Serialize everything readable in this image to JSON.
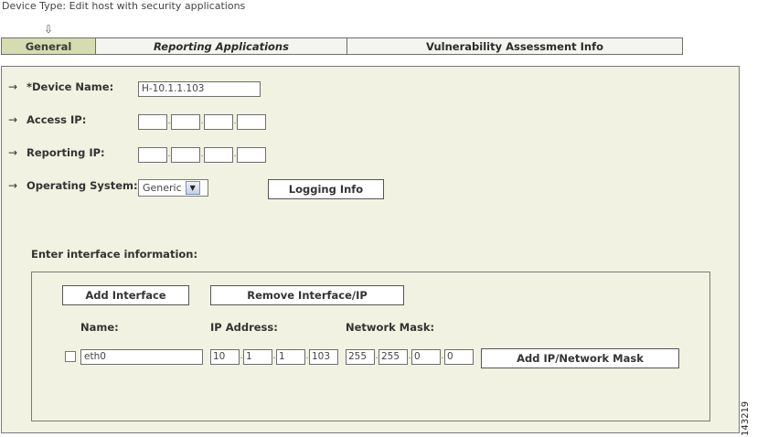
{
  "header": {
    "device_type_label": "Device Type:",
    "device_type_value": " Edit host with security applications"
  },
  "tabs": [
    {
      "label": "General",
      "active": true
    },
    {
      "label": "Reporting Applications",
      "active": false
    },
    {
      "label": "Vulnerability Assessment Info",
      "active": false
    }
  ],
  "form": {
    "device_name_label": "*Device Name:",
    "device_name_value": "H-10.1.1.103",
    "access_ip_label": "Access IP:",
    "reporting_ip_label": "Reporting IP:",
    "os_label": "Operating System:",
    "os_value": "Generic",
    "logging_info_button": "Logging Info"
  },
  "interfaces": {
    "section_label": "Enter interface information:",
    "add_interface_button": "Add Interface",
    "remove_interface_button": "Remove Interface/IP",
    "col_name": "Name:",
    "col_ip": "IP Address:",
    "col_mask": "Network Mask:",
    "rows": [
      {
        "name": "eth0",
        "ip": [
          "10",
          "1",
          "1",
          "103"
        ],
        "mask": [
          "255",
          "255",
          "0",
          "0"
        ],
        "add_button": "Add IP/Network Mask"
      }
    ]
  },
  "figure_id": "143219",
  "icons": {
    "tab_marker": "down-arrow-icon",
    "row_marker": "right-arrow-icon",
    "select_toggle": "chevron-down-icon"
  },
  "colors": {
    "panel_bg": "#f1f2e1",
    "active_tab": "#d6dcb0"
  }
}
